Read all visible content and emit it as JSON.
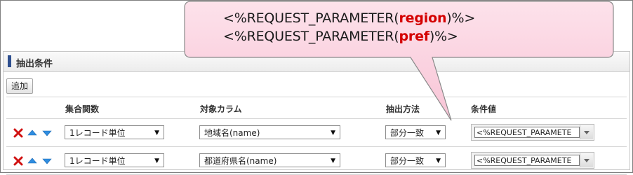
{
  "callout": {
    "line1_prefix": "<%REQUEST_PARAMETER(",
    "line1_param": "region",
    "line1_suffix": ")%>",
    "line2_prefix": "<%REQUEST_PARAMETER(",
    "line2_param": "pref",
    "line2_suffix": ")%>",
    "fill_color": "#fbd3e0",
    "highlight_color": "#d40000"
  },
  "panel": {
    "title": "抽出条件",
    "add_label": "追加",
    "accent_color": "#2e4f8f"
  },
  "table": {
    "headers": {
      "aggregate": "集合関数",
      "column": "対象カラム",
      "method": "抽出方法",
      "value": "条件値"
    },
    "rows": [
      {
        "aggregate": "1レコード単位",
        "column": "地域名(name)",
        "method": "部分一致",
        "value": "<%REQUEST_PARAMETE"
      },
      {
        "aggregate": "1レコード単位",
        "column": "都道府県名(name)",
        "method": "部分一致",
        "value": "<%REQUEST_PARAMETE"
      }
    ]
  },
  "icons": {
    "delete": "delete-x-icon",
    "up": "move-up-icon",
    "down": "move-down-icon",
    "dropdown": "triangle-down-icon"
  }
}
